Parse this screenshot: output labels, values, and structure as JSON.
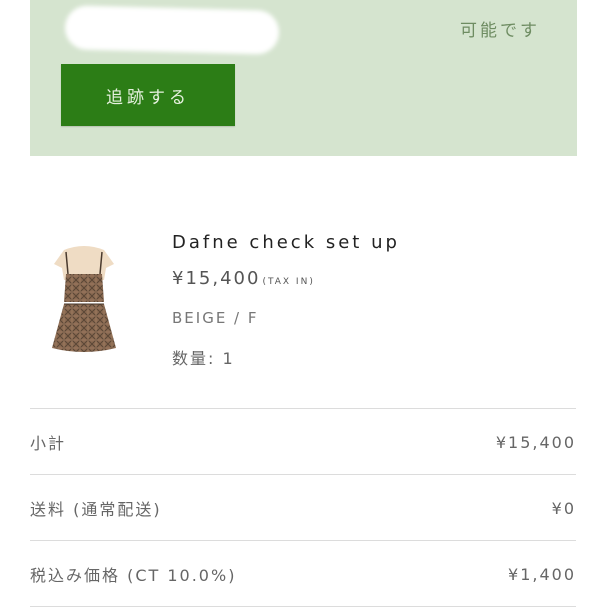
{
  "tracking": {
    "status_text": "可能です",
    "button_label": "追跡する"
  },
  "product": {
    "name": "Dafne check set up",
    "price": "¥15,400",
    "tax_note": "(TAX IN)",
    "variant": "BEIGE / F",
    "quantity": "数量: 1"
  },
  "summary": {
    "rows": [
      {
        "label": "小計",
        "value": "¥15,400"
      },
      {
        "label": "送料 (通常配送)",
        "value": "¥0"
      },
      {
        "label": "税込み価格 (CT 10.0%)",
        "value": "¥1,400"
      }
    ]
  },
  "colors": {
    "panel_bg": "#d5e4cf",
    "button_bg": "#2c7d16",
    "status_text": "#6e8c62"
  }
}
